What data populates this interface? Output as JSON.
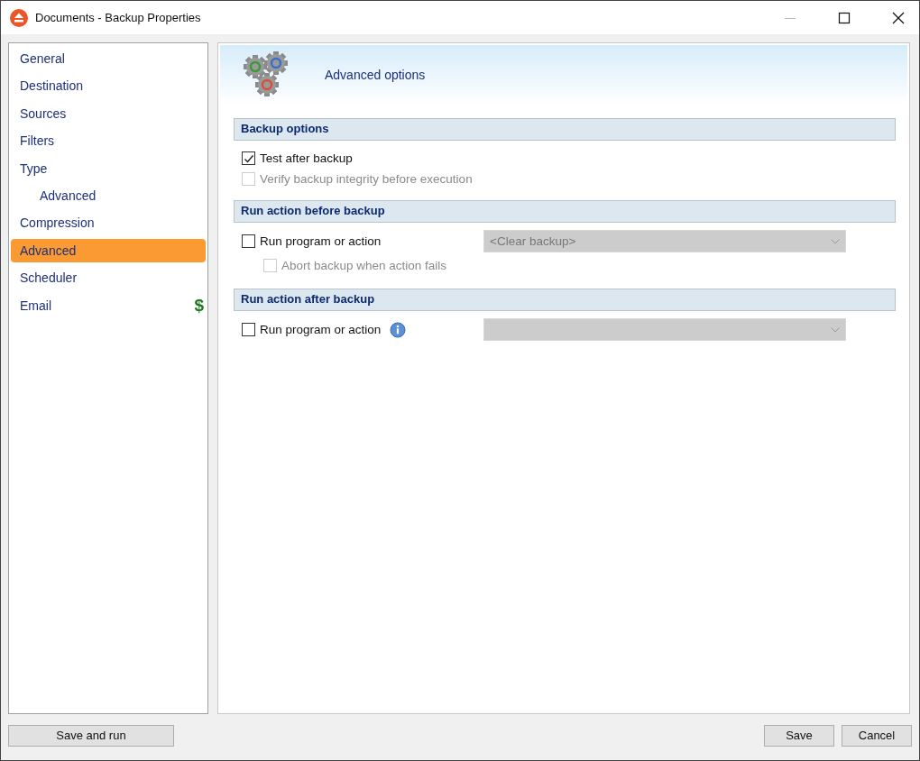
{
  "window": {
    "title": "Documents - Backup Properties"
  },
  "sidebar": {
    "items": [
      {
        "label": "General",
        "selected": false
      },
      {
        "label": "Destination",
        "selected": false
      },
      {
        "label": "Sources",
        "selected": false
      },
      {
        "label": "Filters",
        "selected": false
      },
      {
        "label": "Type",
        "selected": false,
        "children": [
          {
            "label": "Advanced",
            "selected": false
          }
        ]
      },
      {
        "label": "Compression",
        "selected": false
      },
      {
        "label": "Advanced",
        "selected": true
      },
      {
        "label": "Scheduler",
        "selected": false
      },
      {
        "label": "Email",
        "selected": false,
        "badge": "$"
      }
    ]
  },
  "header": {
    "title": "Advanced options"
  },
  "sections": [
    {
      "title": "Backup options",
      "rows": [
        {
          "label": "Test after backup",
          "checked": true,
          "disabled": false
        },
        {
          "label": "Verify backup integrity before execution",
          "checked": false,
          "disabled": true
        }
      ]
    },
    {
      "title": "Run action before backup",
      "rows": [
        {
          "label": "Run program or action",
          "checked": false,
          "disabled": false,
          "dropdown": {
            "value": "<Clear backup>",
            "disabled": true
          }
        },
        {
          "label": "Abort backup when action fails",
          "checked": false,
          "disabled": true,
          "indented": true
        }
      ]
    },
    {
      "title": "Run action after backup",
      "rows": [
        {
          "label": "Run program or action",
          "checked": false,
          "disabled": false,
          "info": true,
          "dropdown": {
            "disabled": true
          }
        }
      ]
    }
  ],
  "buttons": [
    {
      "label": "Save and run",
      "kind": "left"
    },
    {
      "label": "Save",
      "kind": "right"
    },
    {
      "label": "Cancel",
      "kind": "right"
    }
  ]
}
